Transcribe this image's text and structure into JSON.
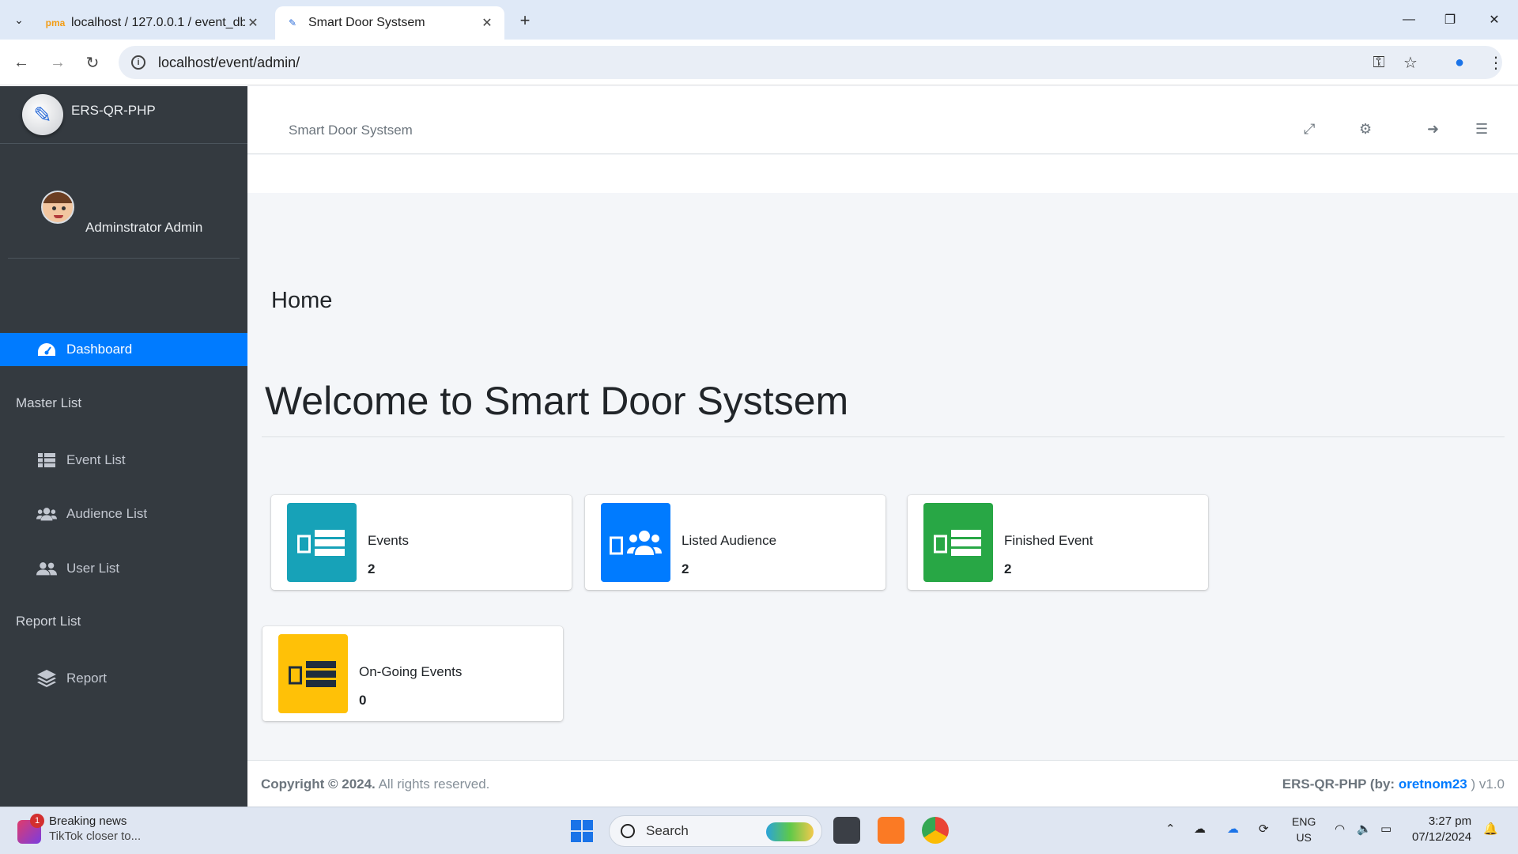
{
  "browser": {
    "tabs": [
      {
        "title": "localhost / 127.0.0.1 / event_db",
        "icon": "phpmyadmin-icon"
      },
      {
        "title": "Smart Door Systsem",
        "icon": "pen-logo-icon"
      }
    ],
    "url": "localhost/event/admin/"
  },
  "brand": {
    "name": "ERS-QR-PHP"
  },
  "user": {
    "name": "Adminstrator Admin"
  },
  "sidebar": {
    "dashboard": "Dashboard",
    "master_header": "Master List",
    "event_list": "Event List",
    "audience_list": "Audience List",
    "user_list": "User List",
    "report_header": "Report List",
    "report": "Report"
  },
  "header": {
    "system_title": "Smart Door Systsem"
  },
  "page": {
    "title": "Home",
    "welcome": "Welcome to Smart Door Systsem"
  },
  "stats": [
    {
      "label": "Events",
      "value": "2",
      "color": "#17a2b8"
    },
    {
      "label": "Listed Audience",
      "value": "2",
      "color": "#007bff"
    },
    {
      "label": "Finished Event",
      "value": "2",
      "color": "#28a745"
    },
    {
      "label": "On-Going Events",
      "value": "0",
      "color": "#ffc107"
    }
  ],
  "footer": {
    "copyright": "Copyright © 2024.",
    "rights": "All rights reserved.",
    "app": "ERS-QR-PHP (by:",
    "author": "oretnom23",
    "version": ") v1.0"
  },
  "taskbar": {
    "news_title": "Breaking news",
    "news_sub": "TikTok closer to...",
    "news_badge": "1",
    "search": "Search",
    "lang1": "ENG",
    "lang2": "US",
    "time": "3:27 pm",
    "date": "07/12/2024"
  }
}
